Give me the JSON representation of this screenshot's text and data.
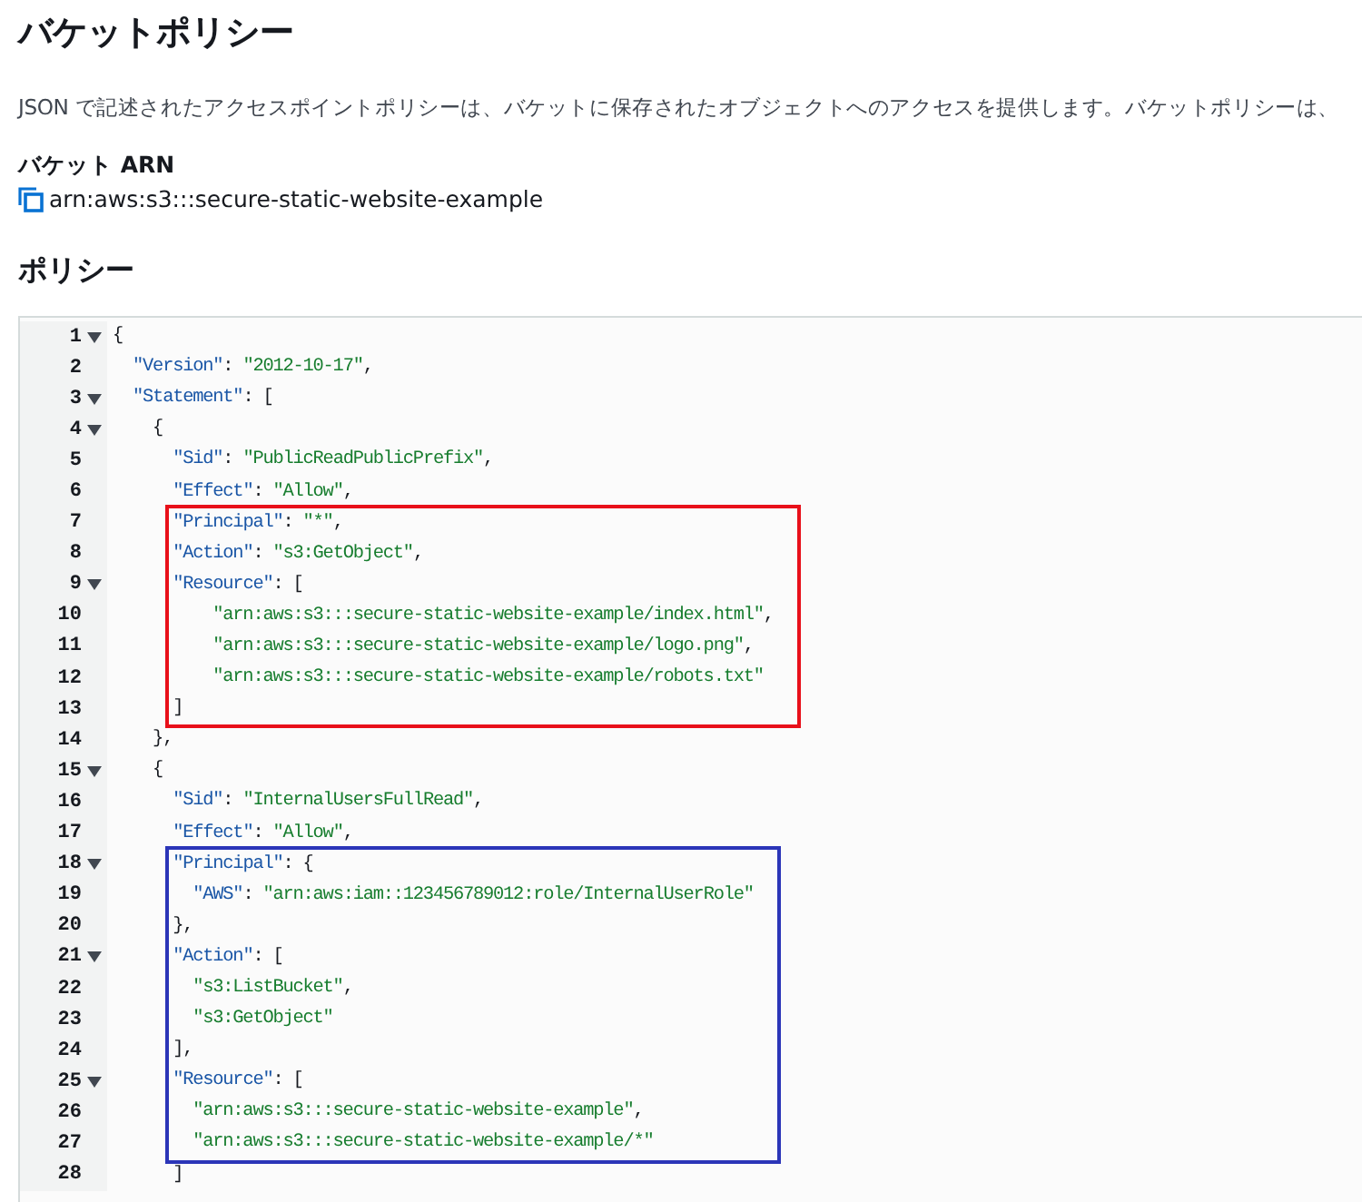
{
  "title": "バケットポリシー",
  "description": "JSON で記述されたアクセスポイントポリシーは、バケットに保存されたオブジェクトへのアクセスを提供します。バケットポリシーは、",
  "bucket_arn": {
    "label": "バケット ARN",
    "value": "arn:aws:s3:::secure-static-website-example"
  },
  "policy_heading": "ポリシー",
  "editor": {
    "blocks": [
      {
        "kind": "plain",
        "lines": [
          {
            "number": "1",
            "foldable": true,
            "text": "{"
          },
          {
            "number": "2",
            "foldable": false,
            "text": "  \"Version\": \"2012-10-17\","
          },
          {
            "number": "3",
            "foldable": true,
            "text": "  \"Statement\": ["
          },
          {
            "number": "4",
            "foldable": true,
            "text": "    {"
          },
          {
            "number": "5",
            "foldable": false,
            "text": "      \"Sid\": \"PublicReadPublicPrefix\","
          },
          {
            "number": "6",
            "foldable": false,
            "text": "      \"Effect\": \"Allow\","
          }
        ]
      },
      {
        "kind": "boxed",
        "color": "#e8101a",
        "lines": [
          {
            "number": "7",
            "foldable": false,
            "text": "      \"Principal\": \"*\","
          },
          {
            "number": "8",
            "foldable": false,
            "text": "      \"Action\": \"s3:GetObject\","
          },
          {
            "number": "9",
            "foldable": true,
            "text": "      \"Resource\": ["
          },
          {
            "number": "10",
            "foldable": false,
            "text": "          \"arn:aws:s3:::secure-static-website-example/index.html\","
          },
          {
            "number": "11",
            "foldable": false,
            "text": "          \"arn:aws:s3:::secure-static-website-example/logo.png\","
          },
          {
            "number": "12",
            "foldable": false,
            "text": "          \"arn:aws:s3:::secure-static-website-example/robots.txt\""
          },
          {
            "number": "13",
            "foldable": false,
            "text": "      ]"
          }
        ]
      },
      {
        "kind": "plain",
        "lines": [
          {
            "number": "14",
            "foldable": false,
            "text": "    },"
          },
          {
            "number": "15",
            "foldable": true,
            "text": "    {"
          },
          {
            "number": "16",
            "foldable": false,
            "text": "      \"Sid\": \"InternalUsersFullRead\","
          },
          {
            "number": "17",
            "foldable": false,
            "text": "      \"Effect\": \"Allow\","
          }
        ]
      },
      {
        "kind": "boxed",
        "color": "#2b35b8",
        "lines": [
          {
            "number": "18",
            "foldable": true,
            "text": "      \"Principal\": {"
          },
          {
            "number": "19",
            "foldable": false,
            "text": "        \"AWS\": \"arn:aws:iam::123456789012:role/InternalUserRole\""
          },
          {
            "number": "20",
            "foldable": false,
            "text": "      },"
          },
          {
            "number": "21",
            "foldable": true,
            "text": "      \"Action\": ["
          },
          {
            "number": "22",
            "foldable": false,
            "text": "        \"s3:ListBucket\","
          },
          {
            "number": "23",
            "foldable": false,
            "text": "        \"s3:GetObject\""
          },
          {
            "number": "24",
            "foldable": false,
            "text": "      ],"
          },
          {
            "number": "25",
            "foldable": true,
            "text": "      \"Resource\": ["
          },
          {
            "number": "26",
            "foldable": false,
            "text": "        \"arn:aws:s3:::secure-static-website-example\","
          },
          {
            "number": "27",
            "foldable": false,
            "text": "        \"arn:aws:s3:::secure-static-website-example/*\""
          }
        ]
      },
      {
        "kind": "plain",
        "lines": [
          {
            "number": "28",
            "foldable": false,
            "text": "      ]"
          }
        ]
      }
    ]
  }
}
